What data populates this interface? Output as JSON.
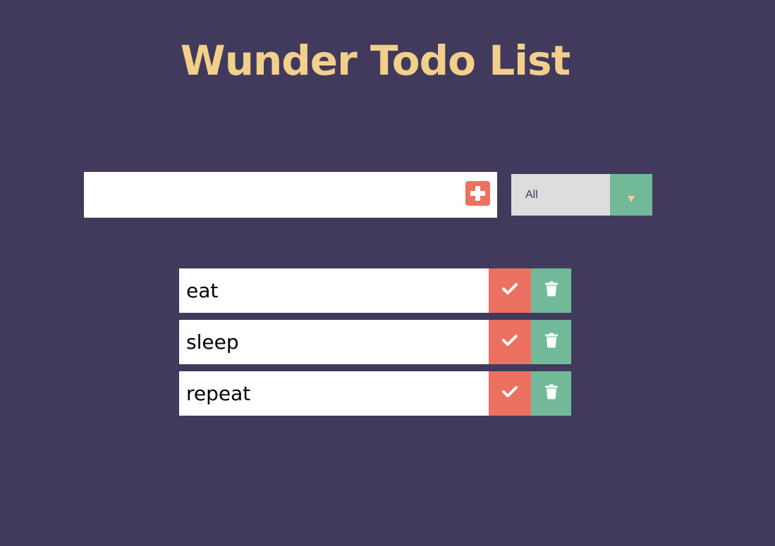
{
  "header": {
    "title": "Wunder Todo List"
  },
  "todo_input": {
    "value": "",
    "placeholder": ""
  },
  "add_button": {
    "icon": "plus-square-icon"
  },
  "filter": {
    "selected": "All",
    "icon": "caret-down-icon"
  },
  "todos": [
    {
      "text": "eat"
    },
    {
      "text": "sleep"
    },
    {
      "text": "repeat"
    }
  ],
  "item_actions": {
    "complete_icon": "check-icon",
    "delete_icon": "trash-icon"
  },
  "colors": {
    "background": "#413a5d",
    "title": "#f2cf8a",
    "accent_red": "#ec7161",
    "accent_green": "#72b999",
    "select_bg": "#dddddd"
  }
}
